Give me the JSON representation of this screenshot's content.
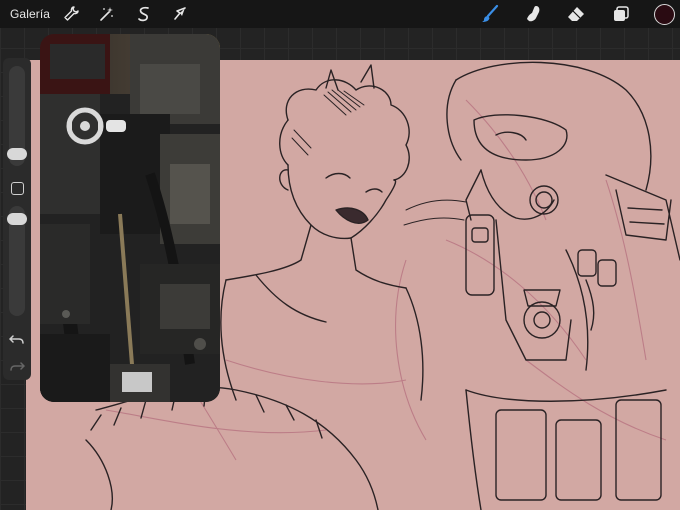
{
  "app": {
    "gallery_label": "Galería"
  },
  "toolbar": {
    "left_tools": [
      {
        "name": "actions",
        "icon": "wrench-icon"
      },
      {
        "name": "adjustments",
        "icon": "magic-wand-icon"
      },
      {
        "name": "selection",
        "icon": "selection-s-icon"
      },
      {
        "name": "transform",
        "icon": "arrow-cursor-icon"
      }
    ],
    "right_tools": [
      {
        "name": "brush",
        "icon": "brush-icon",
        "active": true
      },
      {
        "name": "smudge",
        "icon": "smudge-finger-icon",
        "active": false
      },
      {
        "name": "eraser",
        "icon": "eraser-icon",
        "active": false
      },
      {
        "name": "layers",
        "icon": "layers-icon",
        "active": false
      }
    ],
    "active_color": "#2a0b12",
    "accent_color": "#3a8ee6"
  },
  "canvas": {
    "background_color": "#d2a8a3",
    "line_color": "#2a2224",
    "sketch_color": "#b56f7e"
  },
  "sidebar": {
    "brush_size_level": 0.72,
    "opacity_level": 0.22,
    "undo_icon": "undo-icon",
    "redo_icon": "redo-icon",
    "modifier_icon": "square-modifier-icon"
  },
  "reference": {
    "visible": true
  }
}
